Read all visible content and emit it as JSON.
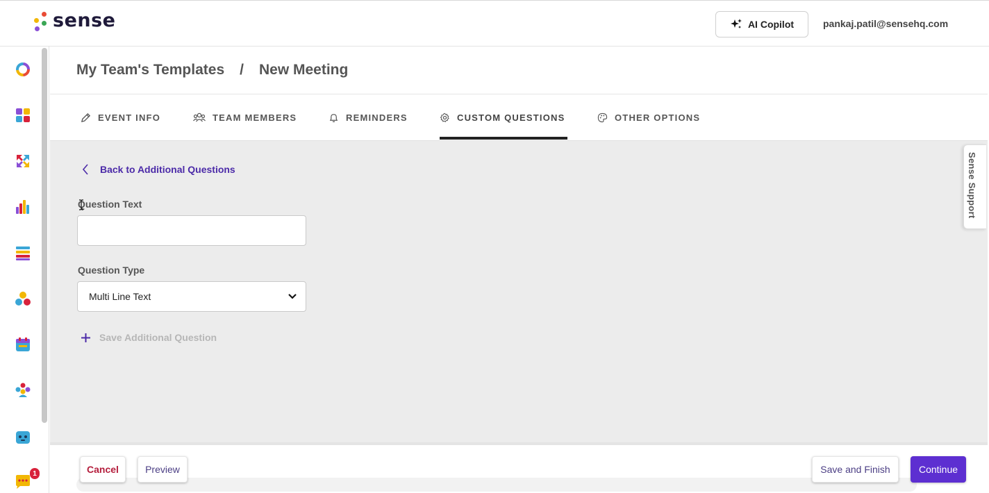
{
  "header": {
    "logo_text": "sense",
    "copilot_label": "AI Copilot",
    "user_email": "pankaj.patil@sensehq.com"
  },
  "breadcrumb": {
    "parent": "My Team's Templates",
    "separator": "/",
    "current": "New Meeting"
  },
  "tabs": [
    {
      "label": "EVENT INFO",
      "icon": "pencil-icon"
    },
    {
      "label": "TEAM MEMBERS",
      "icon": "team-icon"
    },
    {
      "label": "REMINDERS",
      "icon": "bell-icon"
    },
    {
      "label": "CUSTOM QUESTIONS",
      "icon": "gear-icon",
      "active": true
    },
    {
      "label": "OTHER OPTIONS",
      "icon": "palette-icon"
    }
  ],
  "form": {
    "back_label": "Back to Additional Questions",
    "question_text_label": "Question Text",
    "question_text_value": "",
    "question_type_label": "Question Type",
    "question_type_value": "Multi Line Text",
    "save_label": "Save Additional Question"
  },
  "support": {
    "label": "Sense Support"
  },
  "footer": {
    "cancel": "Cancel",
    "preview": "Preview",
    "save_finish": "Save and Finish",
    "continue": "Continue"
  },
  "sidebar": {
    "icons": [
      "donut-icon",
      "apps-icon",
      "arrows-icon",
      "bar-chart-icon",
      "list-icon",
      "people-icon",
      "calendar-icon",
      "team-icon",
      "bot-icon",
      "chat-icon"
    ],
    "chat_badge": "1"
  },
  "colors": {
    "accent": "#5d2fd1",
    "link": "#4b2aa8",
    "cancel": "#b41d3c",
    "main_bg": "#ececec"
  }
}
